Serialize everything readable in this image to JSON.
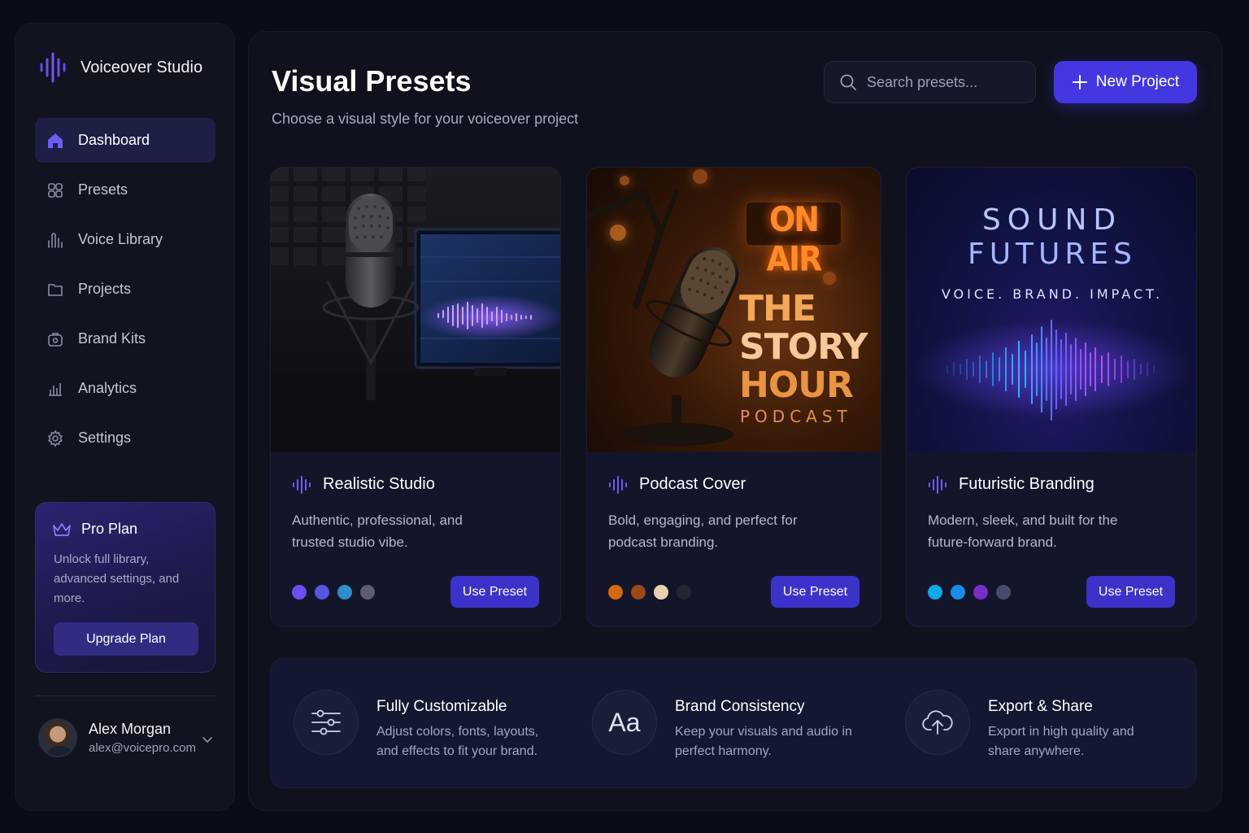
{
  "app": {
    "name": "Voiceover Studio"
  },
  "sidebar": {
    "items": [
      {
        "label": "Dashboard",
        "icon": "home-icon",
        "active": true
      },
      {
        "label": "Presets",
        "icon": "presets-icon"
      },
      {
        "label": "Voice Library",
        "icon": "voice-library-icon"
      },
      {
        "label": "Projects",
        "icon": "folder-icon"
      },
      {
        "label": "Brand Kits",
        "icon": "brand-kit-icon"
      },
      {
        "label": "Analytics",
        "icon": "analytics-icon"
      },
      {
        "label": "Settings",
        "icon": "gear-icon"
      }
    ],
    "promo": {
      "title": "Pro Plan",
      "text": "Unlock full library, advanced settings, and more.",
      "button": "Upgrade Plan"
    },
    "user": {
      "name": "Alex Morgan",
      "email": "alex@voicepro.com"
    }
  },
  "header": {
    "title": "Visual Presets",
    "subtitle": "Choose a visual style for your voiceover project",
    "search_placeholder": "Search presets...",
    "new_button": "New Project"
  },
  "presets": [
    {
      "title": "Realistic Studio",
      "description": "Authentic, professional, and trusted studio vibe.",
      "swatches": [
        "#6c4df0",
        "#5457e0",
        "#2f8fc9",
        "#5a5c78"
      ],
      "button": "Use Preset"
    },
    {
      "title": "Podcast Cover",
      "description": "Bold, engaging, and perfect for podcast branding.",
      "swatches": [
        "#d46a12",
        "#9a4a16",
        "#e7d2b0",
        "#25262e"
      ],
      "button": "Use Preset",
      "image_text": {
        "sign": "ON AIR",
        "line1": "THE",
        "line2": "STORY",
        "line3": "HOUR",
        "line4": "PODCAST"
      }
    },
    {
      "title": "Futuristic Branding",
      "description": "Modern, sleek, and built for the future-forward brand.",
      "swatches": [
        "#13a9e8",
        "#1c8be6",
        "#7a2cc8",
        "#474a6c"
      ],
      "button": "Use Preset",
      "image_text": {
        "line1": "SOUND",
        "line2": "FUTURES",
        "tagline": "VOICE. BRAND. IMPACT."
      }
    }
  ],
  "features": [
    {
      "title": "Fully Customizable",
      "text": "Adjust colors, fonts, layouts, and effects to fit your brand.",
      "icon": "sliders-icon"
    },
    {
      "title": "Brand Consistency",
      "text": "Keep your visuals and audio in perfect harmony.",
      "icon": "typography-icon",
      "icon_text": "Aa"
    },
    {
      "title": "Export & Share",
      "text": "Export in high quality and share anywhere.",
      "icon": "cloud-upload-icon"
    }
  ],
  "colors": {
    "accent": "#4338e0",
    "background": "#0a0c17",
    "sidebar_active": "#1d1f45"
  }
}
